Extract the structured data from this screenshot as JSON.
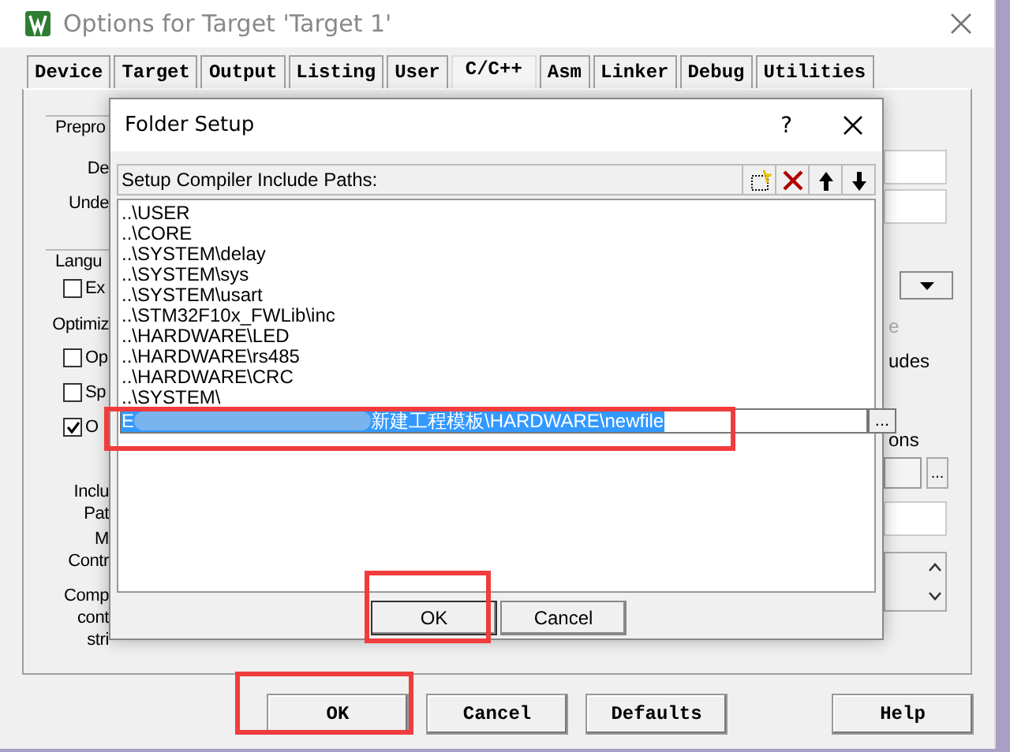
{
  "window": {
    "title": "Options for Target 'Target 1'"
  },
  "tabs": [
    {
      "label": "Device",
      "selected": false
    },
    {
      "label": "Target",
      "selected": false
    },
    {
      "label": "Output",
      "selected": false
    },
    {
      "label": "Listing",
      "selected": false
    },
    {
      "label": "User",
      "selected": false
    },
    {
      "label": "C/C++",
      "selected": true
    },
    {
      "label": "Asm",
      "selected": false
    },
    {
      "label": "Linker",
      "selected": false
    },
    {
      "label": "Debug",
      "selected": false
    },
    {
      "label": "Utilities",
      "selected": false
    }
  ],
  "left_fragments": [
    {
      "kind": "group",
      "text": "Prepro"
    },
    {
      "kind": "label",
      "text": "De"
    },
    {
      "kind": "label",
      "text": "Unde"
    },
    {
      "kind": "group",
      "text": "Langu"
    },
    {
      "kind": "checkbox",
      "text": "Ex",
      "checked": false
    },
    {
      "kind": "label",
      "text": "Optimiz"
    },
    {
      "kind": "checkbox",
      "text": "Op",
      "checked": false
    },
    {
      "kind": "checkbox",
      "text": "Sp",
      "checked": false
    },
    {
      "kind": "checkbox",
      "text": "O",
      "checked": true
    },
    {
      "kind": "label",
      "text": "Inclu"
    },
    {
      "kind": "label",
      "text": "Pat"
    },
    {
      "kind": "label",
      "text": "M"
    },
    {
      "kind": "label",
      "text": "Contr"
    },
    {
      "kind": "label",
      "text": "Comp"
    },
    {
      "kind": "label",
      "text": "cont"
    },
    {
      "kind": "label",
      "text": "stri"
    }
  ],
  "right_fragments": [
    {
      "kind": "field"
    },
    {
      "kind": "field"
    },
    {
      "kind": "dropdown"
    },
    {
      "kind": "label",
      "text": "e",
      "disabled": true
    },
    {
      "kind": "label",
      "text": "udes",
      "disabled": false
    },
    {
      "kind": "label",
      "text": "ons",
      "disabled": false
    },
    {
      "kind": "browse",
      "text": "..."
    },
    {
      "kind": "field"
    },
    {
      "kind": "scrollbox"
    }
  ],
  "folder_setup": {
    "title": "Folder Setup",
    "help": "?",
    "header": "Setup Compiler Include Paths:",
    "paths": [
      "..\\USER",
      "..\\CORE",
      "..\\SYSTEM\\delay",
      "..\\SYSTEM\\sys",
      "..\\SYSTEM\\usart",
      "..\\STM32F10x_FWLib\\inc",
      "..\\HARDWARE\\LED",
      "..\\HARDWARE\\rs485",
      "..\\HARDWARE\\CRC",
      "..\\SYSTEM\\"
    ],
    "edit": {
      "value_start": "E",
      "value_end": "新建工程模板\\HARDWARE\\newfile",
      "redacted": true,
      "browse": "...",
      "highlighted": true
    },
    "buttons": [
      {
        "label": "OK",
        "highlighted": true
      },
      {
        "label": "Cancel",
        "highlighted": false
      }
    ]
  },
  "buttons": [
    {
      "label": "OK",
      "highlighted": true
    },
    {
      "label": "Cancel",
      "highlighted": false
    },
    {
      "label": "Defaults",
      "highlighted": false
    },
    {
      "label": "Help",
      "highlighted": false
    }
  ]
}
